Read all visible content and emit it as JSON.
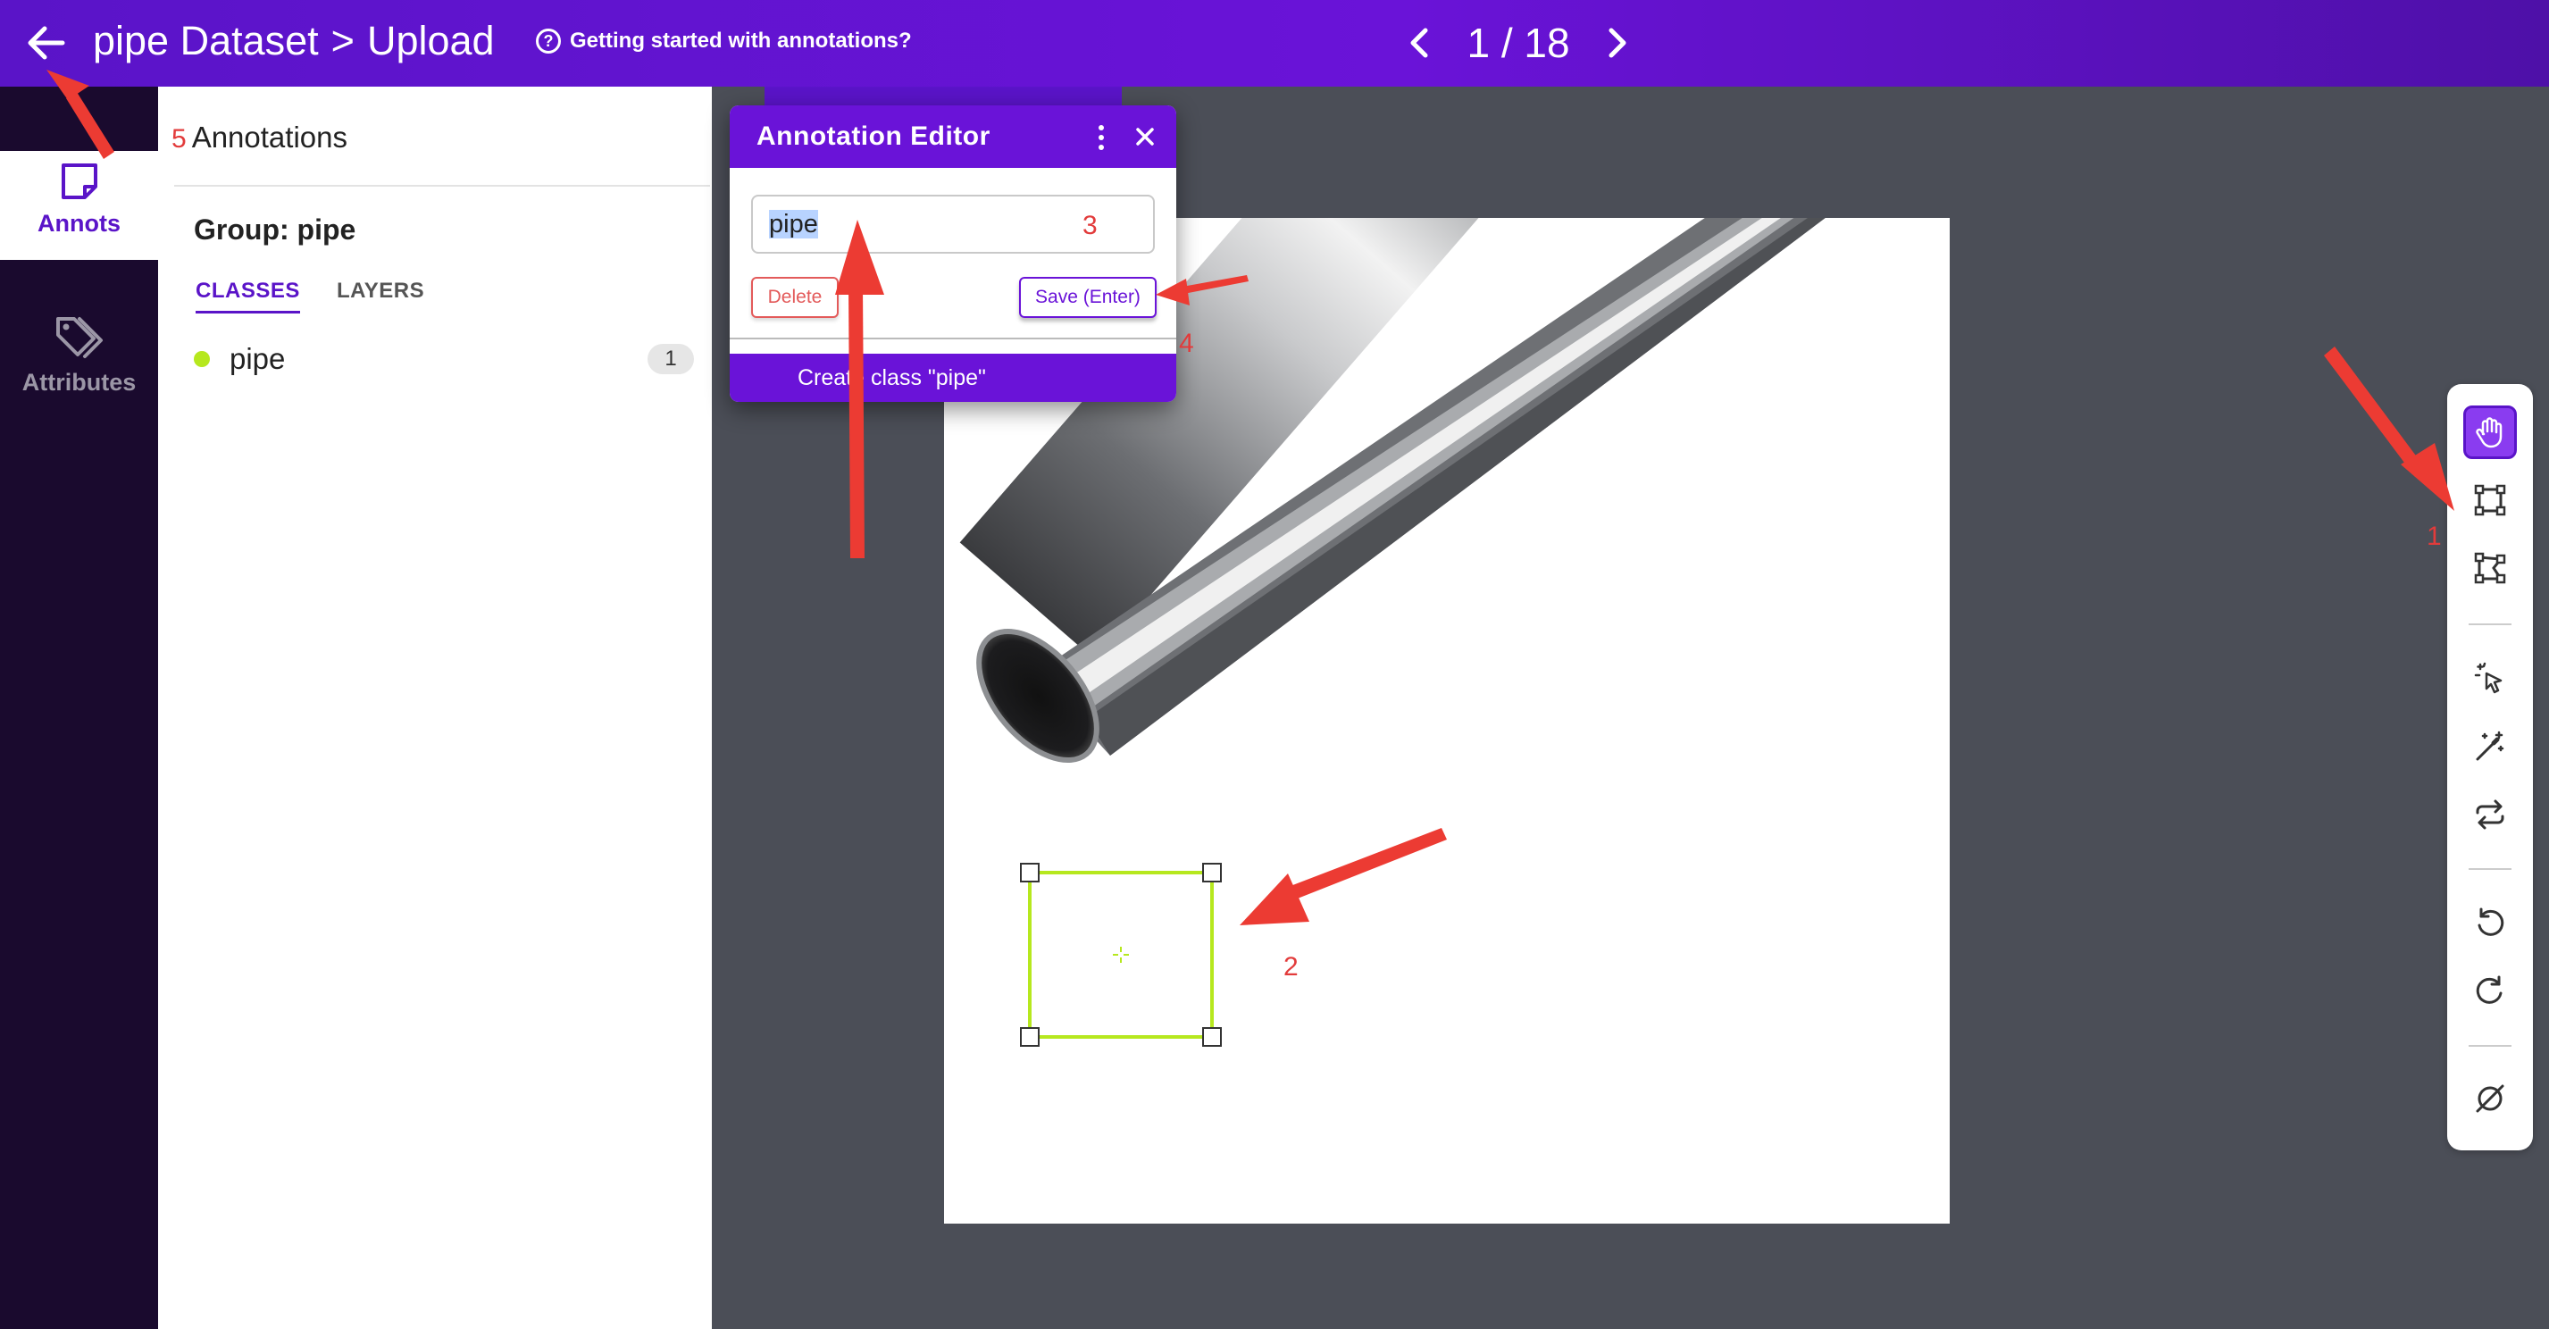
{
  "topbar": {
    "dataset": "pipe Dataset",
    "separator": ">",
    "page": "Upload",
    "help_text": "Getting started with annotations?",
    "help_icon": "?",
    "pager_text": "1 / 18"
  },
  "rail": {
    "annots_label": "Annots",
    "attributes_label": "Attributes"
  },
  "panel": {
    "annotations_title": "Annotations",
    "group_title": "Group: pipe",
    "tabs": [
      "CLASSES",
      "LAYERS"
    ],
    "classes": [
      {
        "name": "pipe",
        "count": "1",
        "color": "#b6e81e"
      }
    ]
  },
  "editor": {
    "title": "Annotation Editor",
    "input_value": "pipe",
    "delete_label": "Delete",
    "save_label": "Save (Enter)",
    "create_label": "Create class \"pipe\""
  },
  "toolbar": {
    "tools": [
      "pan-hand-icon",
      "bounding-box-icon",
      "polygon-icon",
      "magic-select-icon",
      "magic-wand-icon",
      "repeat-icon",
      "undo-icon",
      "redo-icon",
      "clear-icon"
    ],
    "active_tool": "pan-hand-icon"
  },
  "instructions": {
    "n1": "1",
    "n2": "2",
    "n3": "3",
    "n4": "4",
    "n5": "5"
  },
  "colors": {
    "brand": "#6a13d8",
    "annotation_box": "#b6e81e",
    "instruction_red": "#e23b3b"
  }
}
